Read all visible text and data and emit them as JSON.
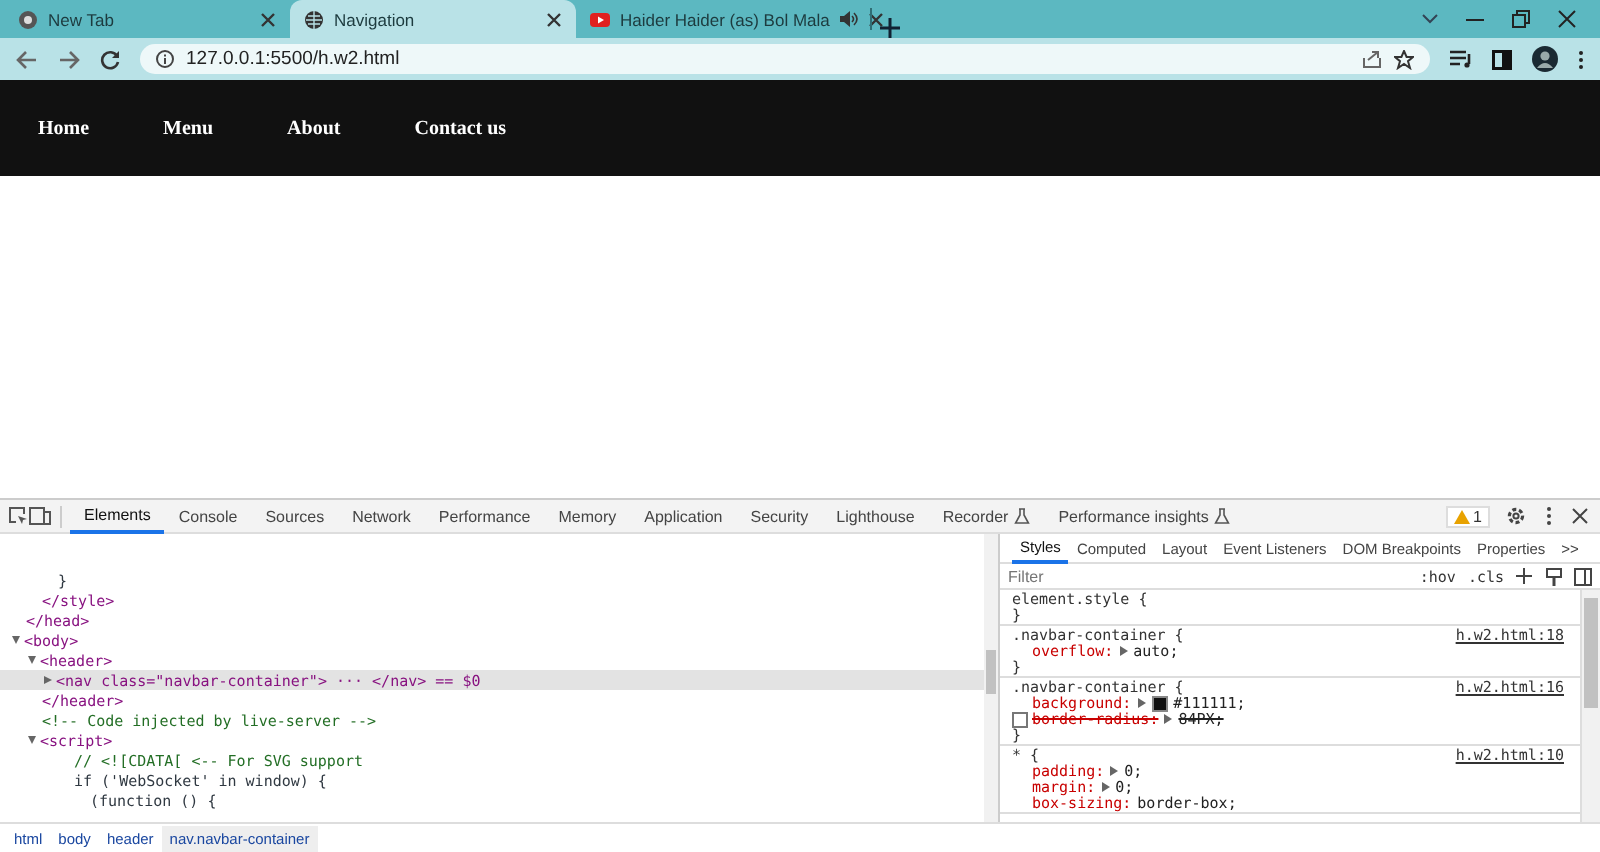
{
  "browser": {
    "tabs": [
      {
        "title": "New Tab",
        "audio": false,
        "selected": false
      },
      {
        "title": "Navigation",
        "audio": false,
        "selected": true
      },
      {
        "title": "Haider Haider (as) Bol Mala",
        "audio": true,
        "selected": false
      }
    ],
    "address": "127.0.0.1:5500/h.w2.html"
  },
  "page": {
    "nav_links": [
      "Home",
      "Menu",
      "About",
      "Contact us"
    ]
  },
  "devtools": {
    "tabs": [
      {
        "label": "Elements",
        "experimental": false,
        "selected": true
      },
      {
        "label": "Console",
        "experimental": false,
        "selected": false
      },
      {
        "label": "Sources",
        "experimental": false,
        "selected": false
      },
      {
        "label": "Network",
        "experimental": false,
        "selected": false
      },
      {
        "label": "Performance",
        "experimental": false,
        "selected": false
      },
      {
        "label": "Memory",
        "experimental": false,
        "selected": false
      },
      {
        "label": "Application",
        "experimental": false,
        "selected": false
      },
      {
        "label": "Security",
        "experimental": false,
        "selected": false
      },
      {
        "label": "Lighthouse",
        "experimental": false,
        "selected": false
      },
      {
        "label": "Recorder",
        "experimental": true,
        "selected": false
      },
      {
        "label": "Performance insights",
        "experimental": true,
        "selected": false
      }
    ],
    "warning_count": "1",
    "dom_tree": [
      {
        "children": [
          {
            "children": [
              {
                "text": "}",
                "kind": "code",
                "selected": false
              }
            ]
          },
          {
            "text": "</style>",
            "kind": "tag",
            "selected": false
          }
        ]
      },
      {
        "text": "</head>",
        "kind": "tag",
        "selected": false
      },
      {
        "text": "<body>",
        "kind": "tag",
        "selected": false,
        "expanded": true,
        "children": [
          {
            "text": "<header>",
            "kind": "tag",
            "selected": false,
            "expanded": true,
            "children": [
              {
                "text": "<nav class=\"navbar-container\"> ··· </nav> == $0",
                "kind": "tag",
                "selected": true,
                "expanded": false
              }
            ]
          },
          {
            "text": "</header>",
            "kind": "tag",
            "selected": false
          },
          {
            "text": "<!-- Code injected by live-server -->",
            "kind": "comment",
            "selected": false
          },
          {
            "text": "<script>",
            "kind": "tag",
            "selected": false,
            "expanded": true,
            "children": [
              {
                "children": [
                  {
                    "text": "// <![CDATA[  <-- For SVG support",
                    "kind": "comment",
                    "selected": false
                  },
                  {
                    "text": "if ('WebSocket' in window) {",
                    "kind": "code",
                    "selected": false
                  },
                  {
                    "children": [
                      {
                        "text": "(function () {",
                        "kind": "code",
                        "selected": false
                      }
                    ]
                  }
                ]
              }
            ]
          }
        ]
      }
    ],
    "breadcrumbs": [
      {
        "label": "html",
        "selected": false
      },
      {
        "label": "body",
        "selected": false
      },
      {
        "label": "header",
        "selected": false
      },
      {
        "label": "nav.navbar-container",
        "selected": true
      }
    ],
    "side_tabs": [
      {
        "label": "Styles",
        "selected": true
      },
      {
        "label": "Computed",
        "selected": false
      },
      {
        "label": "Layout",
        "selected": false
      },
      {
        "label": "Event Listeners",
        "selected": false
      },
      {
        "label": "DOM Breakpoints",
        "selected": false
      },
      {
        "label": "Properties",
        "selected": false
      }
    ],
    "more_tabs": ">>",
    "filter": {
      "placeholder": "Filter"
    },
    "filter_buttons": [
      ":hov",
      ".cls"
    ],
    "rules": [
      {
        "selector": "element.style {",
        "close": "}"
      },
      {
        "selector": ".navbar-container {",
        "source": "h.w2.html:18",
        "close": "}",
        "declarations": [
          {
            "property": "overflow:",
            "value": "auto;",
            "expandable": true,
            "disabled": false
          }
        ]
      },
      {
        "selector": ".navbar-container {",
        "source": "h.w2.html:16",
        "close": "}",
        "declarations": [
          {
            "property": "background:",
            "value": "#111111;",
            "expandable": true,
            "kind": "color",
            "disabled": false
          },
          {
            "property": "border-radius:",
            "value": "84PX;",
            "expandable": true,
            "disabled": true
          }
        ]
      },
      {
        "selector": "* {",
        "source": "h.w2.html:10",
        "declarations": [
          {
            "property": "padding:",
            "value": "0;",
            "expandable": true,
            "disabled": false
          },
          {
            "property": "margin:",
            "value": "0;",
            "expandable": true,
            "disabled": false
          },
          {
            "property": "box-sizing:",
            "value": "border-box;",
            "expandable": false,
            "disabled": false
          }
        ]
      }
    ]
  }
}
